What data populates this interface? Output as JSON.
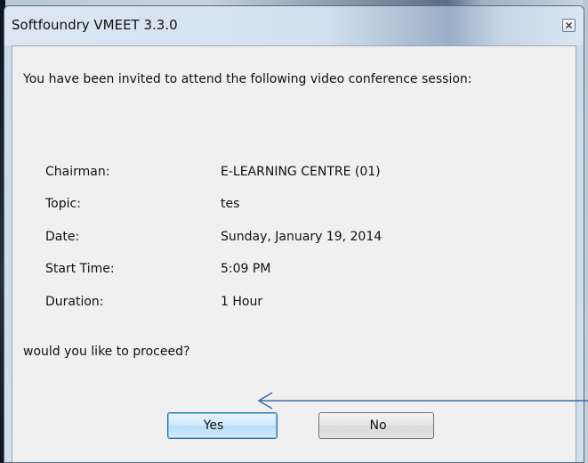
{
  "dialog": {
    "title": "Softfoundry VMEET 3.3.0",
    "intro": "You have been invited to attend the following video conference session:",
    "details": [
      {
        "label": "Chairman:",
        "value": "E-LEARNING CENTRE (01)"
      },
      {
        "label": "Topic:",
        "value": "tes"
      },
      {
        "label": "Date:",
        "value": "Sunday, January 19, 2014"
      },
      {
        "label": "Start Time:",
        "value": "5:09 PM"
      },
      {
        "label": "Duration:",
        "value": "1 Hour"
      }
    ],
    "question": "would you like to proceed?",
    "yes_label": "Yes",
    "no_label": "No"
  },
  "icons": {
    "close": "close-icon",
    "annotation_arrow": "arrow-left-icon"
  },
  "colors": {
    "default_button_border": "#2f6f9f",
    "annotation_arrow": "#3a6fa8"
  }
}
